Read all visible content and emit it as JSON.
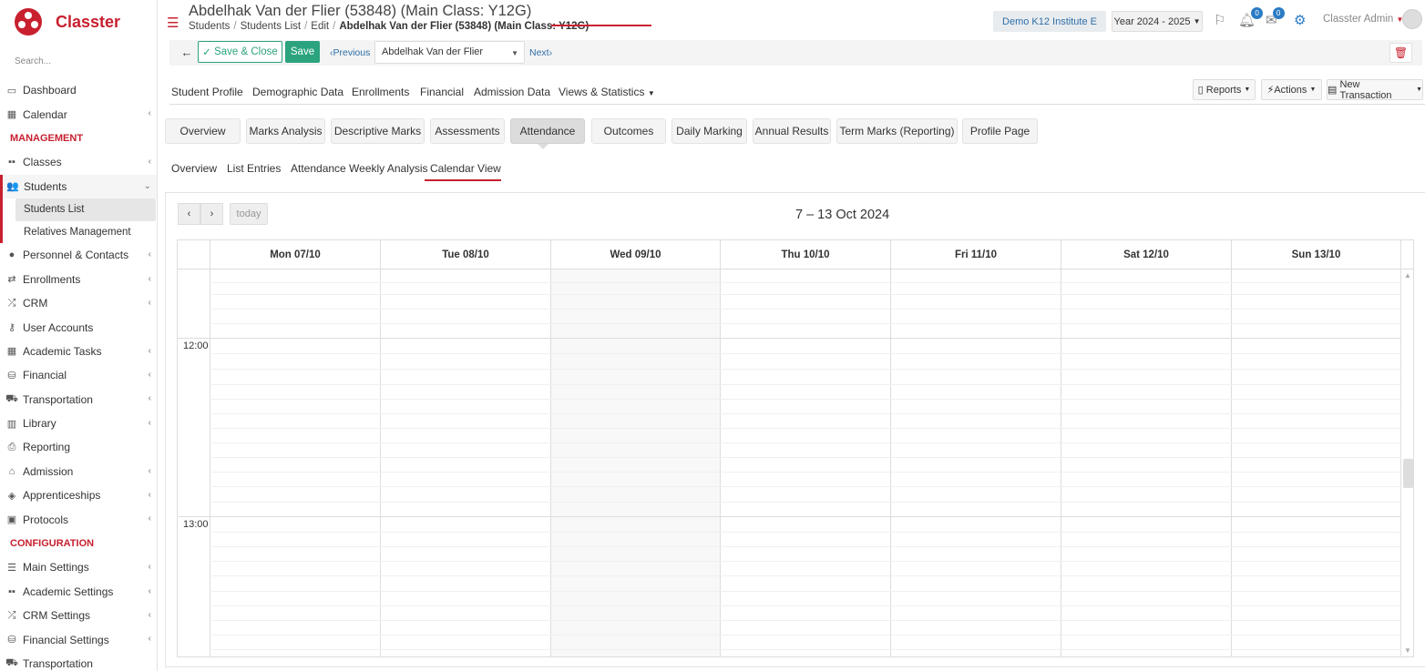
{
  "brand": {
    "name": "Classter"
  },
  "sidebar": {
    "search_placeholder": "Search...",
    "items": [
      {
        "label": "Dashboard"
      },
      {
        "label": "Calendar"
      },
      {
        "section": "MANAGEMENT"
      },
      {
        "label": "Classes"
      },
      {
        "label": "Students"
      },
      {
        "label": "Students List"
      },
      {
        "label": "Relatives Management"
      },
      {
        "label": "Personnel & Contacts"
      },
      {
        "label": "Enrollments"
      },
      {
        "label": "CRM"
      },
      {
        "label": "User Accounts"
      },
      {
        "label": "Academic Tasks"
      },
      {
        "label": "Financial"
      },
      {
        "label": "Transportation"
      },
      {
        "label": "Library"
      },
      {
        "label": "Reporting"
      },
      {
        "label": "Admission"
      },
      {
        "label": "Apprenticeships"
      },
      {
        "label": "Protocols"
      },
      {
        "section": "CONFIGURATION"
      },
      {
        "label": "Main Settings"
      },
      {
        "label": "Academic Settings"
      },
      {
        "label": "CRM Settings"
      },
      {
        "label": "Financial Settings"
      },
      {
        "label": "Transportation"
      }
    ]
  },
  "header": {
    "title": "Abdelhak Van der Flier (53848) (Main Class: Y12G)",
    "breadcrumb": [
      "Students",
      "Students List",
      "Edit",
      "Abdelhak Van der Flier (53848) (Main Class: Y12G)"
    ],
    "institute": "Demo K12 Institute E",
    "year": "Year 2024 - 2025",
    "notifications_count": "0",
    "messages_count": "0",
    "user": "Classter Admin"
  },
  "toolbar": {
    "save_close": "Save & Close",
    "save": "Save",
    "previous": "Previous",
    "student": "Abdelhak Van der Flier",
    "next": "Next"
  },
  "main_tabs": [
    "Student Profile",
    "Demographic Data",
    "Enrollments",
    "Financial",
    "Admission Data",
    "Views & Statistics"
  ],
  "right_buttons": {
    "reports": "Reports",
    "actions": "Actions",
    "new_transaction": "New Transaction"
  },
  "sub_tabs": [
    "Overview",
    "Marks Analysis",
    "Descriptive Marks",
    "Assessments",
    "Attendance",
    "Outcomes",
    "Daily Marking",
    "Annual Results",
    "Term Marks (Reporting)",
    "Profile Page"
  ],
  "attendance_tabs": [
    "Overview",
    "List Entries",
    "Attendance Weekly Analysis",
    "Calendar View"
  ],
  "calendar": {
    "today_label": "today",
    "title": "7 – 13 Oct 2024",
    "days": [
      "Mon 07/10",
      "Tue 08/10",
      "Wed 09/10",
      "Thu 10/10",
      "Fri 11/10",
      "Sat 12/10",
      "Sun 13/10"
    ],
    "times": [
      "12:00",
      "13:00"
    ]
  }
}
